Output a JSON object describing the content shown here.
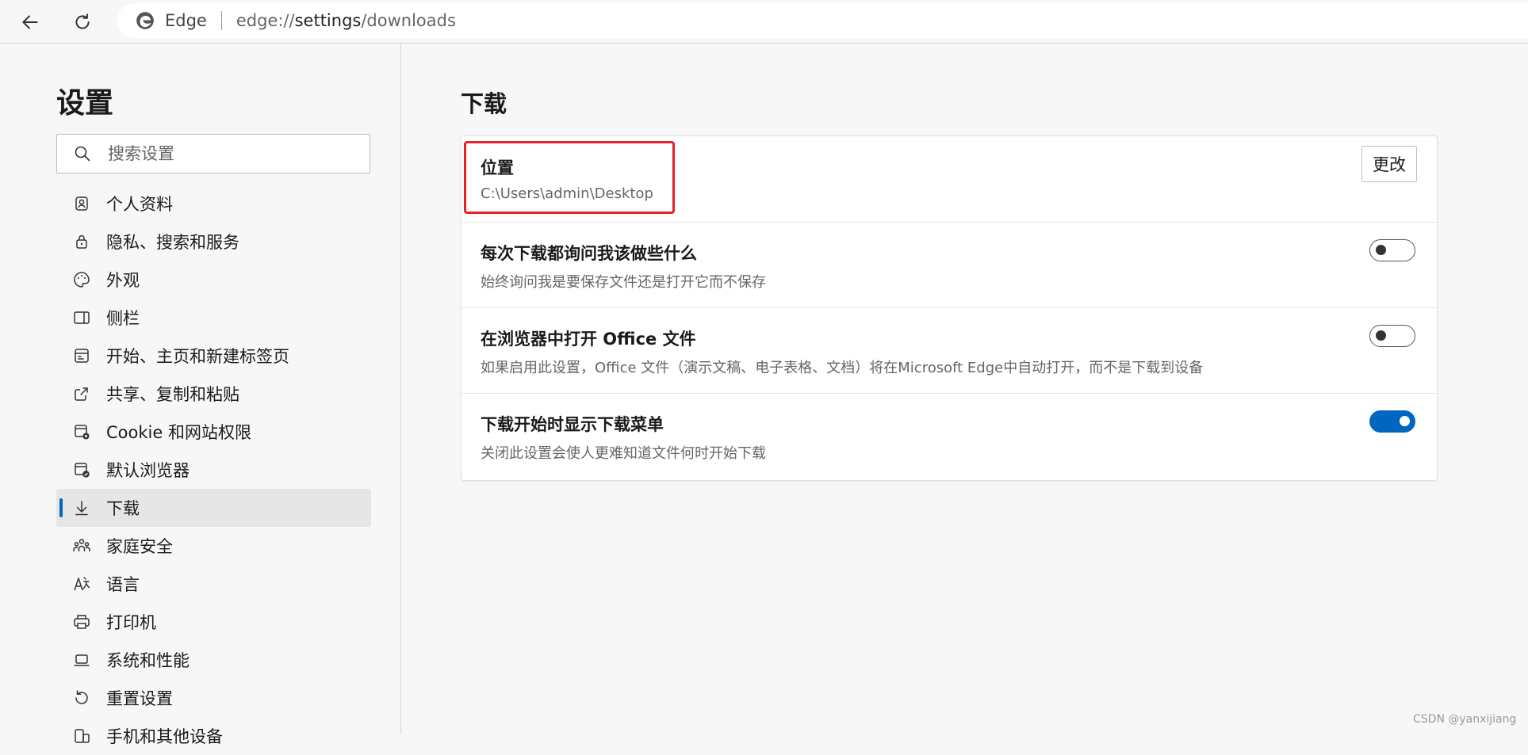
{
  "browser": {
    "name": "Edge",
    "url_prefix": "edge://",
    "url_host": "settings",
    "url_path": "/downloads"
  },
  "sidebar": {
    "title": "设置",
    "search_placeholder": "搜索设置",
    "items": [
      {
        "label": "个人资料",
        "icon": "profile-icon"
      },
      {
        "label": "隐私、搜索和服务",
        "icon": "lock-icon"
      },
      {
        "label": "外观",
        "icon": "palette-icon"
      },
      {
        "label": "侧栏",
        "icon": "sidebar-icon"
      },
      {
        "label": "开始、主页和新建标签页",
        "icon": "home-tab-icon"
      },
      {
        "label": "共享、复制和粘贴",
        "icon": "share-icon"
      },
      {
        "label": "Cookie 和网站权限",
        "icon": "cookie-permission-icon"
      },
      {
        "label": "默认浏览器",
        "icon": "default-browser-icon"
      },
      {
        "label": "下载",
        "icon": "download-icon",
        "active": true
      },
      {
        "label": "家庭安全",
        "icon": "family-icon"
      },
      {
        "label": "语言",
        "icon": "language-icon"
      },
      {
        "label": "打印机",
        "icon": "printer-icon"
      },
      {
        "label": "系统和性能",
        "icon": "laptop-icon"
      },
      {
        "label": "重置设置",
        "icon": "reset-icon"
      },
      {
        "label": "手机和其他设备",
        "icon": "phone-icon"
      }
    ]
  },
  "main": {
    "title": "下载",
    "settings": [
      {
        "title": "位置",
        "desc": "C:\\Users\\admin\\Desktop",
        "control": "button",
        "button_label": "更改"
      },
      {
        "title": "每次下载都询问我该做些什么",
        "desc": "始终询问我是要保存文件还是打开它而不保存",
        "control": "toggle",
        "on": false
      },
      {
        "title": "在浏览器中打开 Office 文件",
        "desc": "如果启用此设置，Office 文件（演示文稿、电子表格、文档）将在Microsoft Edge中自动打开，而不是下载到设备",
        "control": "toggle",
        "on": false
      },
      {
        "title": "下载开始时显示下载菜单",
        "desc": "关闭此设置会使人更难知道文件何时开始下载",
        "control": "toggle",
        "on": true
      }
    ]
  },
  "colors": {
    "accent": "#0067c0",
    "highlight_box": "#e8202a"
  },
  "watermark": "CSDN @yanxijiang"
}
